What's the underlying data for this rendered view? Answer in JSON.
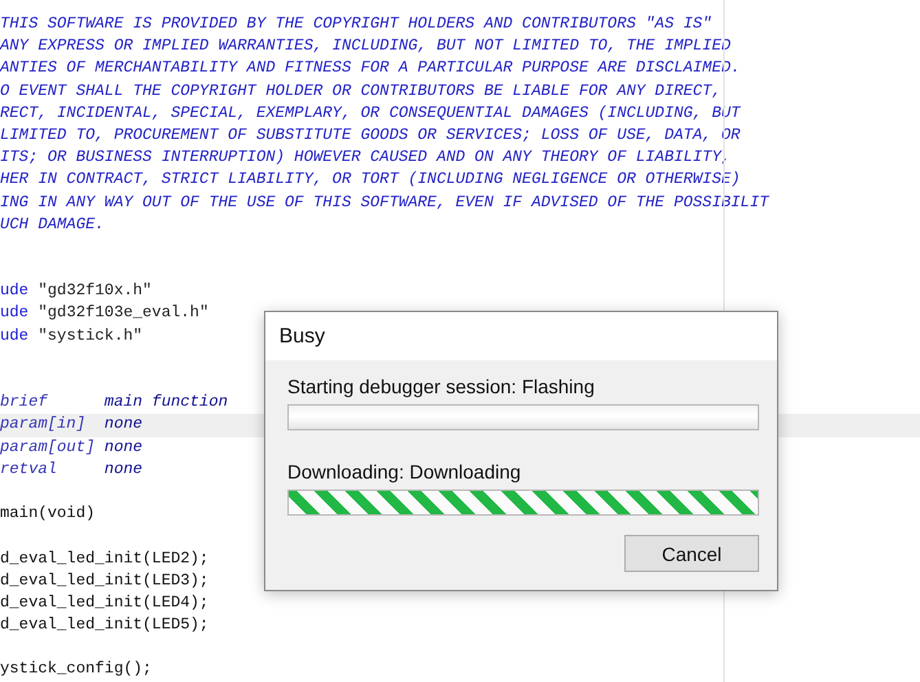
{
  "editor": {
    "lines": [
      {
        "kind": "code",
        "highlighted": false,
        "segments": [
          {
            "kind": "comment",
            "text": "THIS SOFTWARE IS PROVIDED BY THE COPYRIGHT HOLDERS AND CONTRIBUTORS \"AS IS\""
          }
        ]
      },
      {
        "kind": "code",
        "highlighted": false,
        "segments": [
          {
            "kind": "comment",
            "text": "ANY EXPRESS OR IMPLIED WARRANTIES, INCLUDING, BUT NOT LIMITED TO, THE IMPLIED"
          }
        ]
      },
      {
        "kind": "code",
        "highlighted": false,
        "segments": [
          {
            "kind": "comment",
            "text": "ANTIES OF MERCHANTABILITY AND FITNESS FOR A PARTICULAR PURPOSE ARE DISCLAIMED."
          }
        ]
      },
      {
        "kind": "code",
        "highlighted": false,
        "segments": [
          {
            "kind": "comment",
            "text": "O EVENT SHALL THE COPYRIGHT HOLDER OR CONTRIBUTORS BE LIABLE FOR ANY DIRECT,"
          }
        ]
      },
      {
        "kind": "code",
        "highlighted": false,
        "segments": [
          {
            "kind": "comment",
            "text": "RECT, INCIDENTAL, SPECIAL, EXEMPLARY, OR CONSEQUENTIAL DAMAGES (INCLUDING, BUT"
          }
        ]
      },
      {
        "kind": "code",
        "highlighted": false,
        "segments": [
          {
            "kind": "comment",
            "text": "LIMITED TO, PROCUREMENT OF SUBSTITUTE GOODS OR SERVICES; LOSS OF USE, DATA, OR"
          }
        ]
      },
      {
        "kind": "code",
        "highlighted": false,
        "segments": [
          {
            "kind": "comment",
            "text": "ITS; OR BUSINESS INTERRUPTION) HOWEVER CAUSED AND ON ANY THEORY OF LIABILITY,"
          }
        ]
      },
      {
        "kind": "code",
        "highlighted": false,
        "segments": [
          {
            "kind": "comment",
            "text": "HER IN CONTRACT, STRICT LIABILITY, OR TORT (INCLUDING NEGLIGENCE OR OTHERWISE)"
          }
        ]
      },
      {
        "kind": "code",
        "highlighted": false,
        "segments": [
          {
            "kind": "comment",
            "text": "ING IN ANY WAY OUT OF THE USE OF THIS SOFTWARE, EVEN IF ADVISED OF THE POSSIBILIT"
          }
        ]
      },
      {
        "kind": "code",
        "highlighted": false,
        "segments": [
          {
            "kind": "comment",
            "text": "UCH DAMAGE."
          }
        ]
      },
      {
        "kind": "blank"
      },
      {
        "kind": "blank"
      },
      {
        "kind": "code",
        "highlighted": false,
        "segments": [
          {
            "kind": "keyword",
            "text": "ude"
          },
          {
            "kind": "string",
            "text": " \"gd32f10x.h\""
          }
        ]
      },
      {
        "kind": "code",
        "highlighted": false,
        "segments": [
          {
            "kind": "keyword",
            "text": "ude"
          },
          {
            "kind": "string",
            "text": " \"gd32f103e_eval.h\""
          }
        ]
      },
      {
        "kind": "code",
        "highlighted": false,
        "segments": [
          {
            "kind": "keyword",
            "text": "ude"
          },
          {
            "kind": "string",
            "text": " \"systick.h\""
          }
        ]
      },
      {
        "kind": "blank"
      },
      {
        "kind": "blank"
      },
      {
        "kind": "code",
        "highlighted": false,
        "segments": [
          {
            "kind": "doc-tag",
            "text": "brief"
          },
          {
            "kind": "comment-text",
            "text": "      main function"
          }
        ]
      },
      {
        "kind": "code",
        "highlighted": true,
        "segments": [
          {
            "kind": "doc-tag",
            "text": "param[in]"
          },
          {
            "kind": "comment-text",
            "text": "  none"
          }
        ]
      },
      {
        "kind": "code",
        "highlighted": false,
        "segments": [
          {
            "kind": "doc-tag",
            "text": "param[out]"
          },
          {
            "kind": "comment-text",
            "text": " none"
          }
        ]
      },
      {
        "kind": "code",
        "highlighted": false,
        "segments": [
          {
            "kind": "doc-tag",
            "text": "retval"
          },
          {
            "kind": "comment-text",
            "text": "     none"
          }
        ]
      },
      {
        "kind": "blank"
      },
      {
        "kind": "code",
        "highlighted": false,
        "segments": [
          {
            "kind": "plain",
            "text": "main(void)"
          }
        ]
      },
      {
        "kind": "blank"
      },
      {
        "kind": "code",
        "highlighted": false,
        "segments": [
          {
            "kind": "plain",
            "text": "d_eval_led_init(LED2);"
          }
        ]
      },
      {
        "kind": "code",
        "highlighted": false,
        "segments": [
          {
            "kind": "plain",
            "text": "d_eval_led_init(LED3);"
          }
        ]
      },
      {
        "kind": "code",
        "highlighted": false,
        "segments": [
          {
            "kind": "plain",
            "text": "d_eval_led_init(LED4);"
          }
        ]
      },
      {
        "kind": "code",
        "highlighted": false,
        "segments": [
          {
            "kind": "plain",
            "text": "d_eval_led_init(LED5);"
          }
        ]
      },
      {
        "kind": "blank"
      },
      {
        "kind": "code",
        "highlighted": false,
        "segments": [
          {
            "kind": "plain",
            "text": "ystick_config();"
          }
        ]
      }
    ]
  },
  "dialog": {
    "title": "Busy",
    "progress": [
      {
        "label": "Starting debugger session: Flashing",
        "kind": "bar",
        "level": 0
      },
      {
        "label": "Downloading: Downloading",
        "kind": "marquee",
        "level": 1
      }
    ],
    "buttons": [
      "Cancel"
    ]
  }
}
